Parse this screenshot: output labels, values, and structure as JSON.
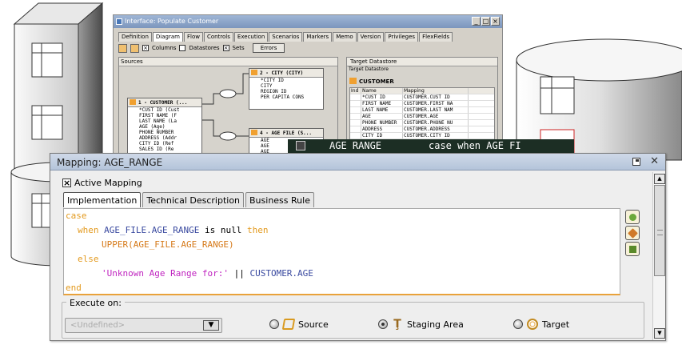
{
  "background_window": {
    "title": "Interface: Populate Customer",
    "tabs": [
      "Definition",
      "Diagram",
      "Flow",
      "Controls",
      "Execution",
      "Scenarios",
      "Markers",
      "Memo",
      "Version",
      "Privileges",
      "FlexFields"
    ],
    "active_tab": "Diagram",
    "toolbar": {
      "columns_label": "Columns",
      "datastores_label": "Datastores",
      "sets_label": "Sets",
      "errors_label": "Errors"
    },
    "sources_panel": {
      "title": "Sources",
      "customer_entity": {
        "title": "1 - CUSTOMER (...",
        "rows": [
          "*CUST ID (Cust",
          "FIRST NAME (F",
          "LAST NAME (La",
          "AGE (Age)",
          "PHONE NUMBER",
          "ADDRESS (Addr",
          "CITY ID (Ref",
          "SALES ID (Re"
        ]
      },
      "city_entity": {
        "title": "2 - CITY (CITY)",
        "rows": [
          "*CITY ID",
          "CITY",
          "REGION ID",
          "PER CAPITA CONS"
        ]
      },
      "age_entity": {
        "title": "4 - AGE FILE (S...",
        "rows": [
          "AGE",
          "AGE",
          "AGE"
        ]
      }
    },
    "target_panel": {
      "title": "Target Datastore",
      "subtitle": "Target Datastore",
      "table_name": "CUSTOMER",
      "columns": [
        "Ind",
        "Name",
        "Mapping"
      ],
      "rows": [
        [
          "",
          "*CUST ID",
          "CUSTOMER.CUST ID"
        ],
        [
          "",
          "FIRST NAME",
          "CUSTOMER.FIRST NA"
        ],
        [
          "",
          "LAST NAME",
          "CUSTOMER.LAST NAM"
        ],
        [
          "",
          "AGE",
          "CUSTOMER.AGE"
        ],
        [
          "",
          "PHONE NUMBER",
          "CUSTOMER.PHONE NU"
        ],
        [
          "",
          "ADDRESS",
          "CUSTOMER.ADDRESS"
        ],
        [
          "",
          "CITY ID",
          "CUSTOMER.CITY ID"
        ]
      ]
    }
  },
  "tooltip": {
    "column": "AGE RANGE",
    "expression": "case  when AGE FI"
  },
  "dialog": {
    "title": "Mapping: AGE_RANGE",
    "active_mapping_label": "Active Mapping",
    "active_mapping_checked": true,
    "tabs": [
      "Implementation",
      "Technical Description",
      "Business Rule"
    ],
    "active_tab": "Implementation",
    "code": {
      "l1": "case",
      "l2_kw1": "when",
      "l2_id": "AGE_FILE.AGE_RANGE",
      "l2_pl": "is null",
      "l2_kw2": "then",
      "l3": "UPPER(AGE_FILE.AGE_RANGE)",
      "l4": "else",
      "l5_str": "'Unknown Age Range for:'",
      "l5_op": "||",
      "l5_id": "CUSTOMER.AGE",
      "l6": "end"
    },
    "execute_on": {
      "label": "Execute on:",
      "select_value": "<Undefined>",
      "options": [
        {
          "label": "Source",
          "selected": false
        },
        {
          "label": "Staging Area",
          "selected": true
        },
        {
          "label": "Target",
          "selected": false
        }
      ]
    }
  }
}
